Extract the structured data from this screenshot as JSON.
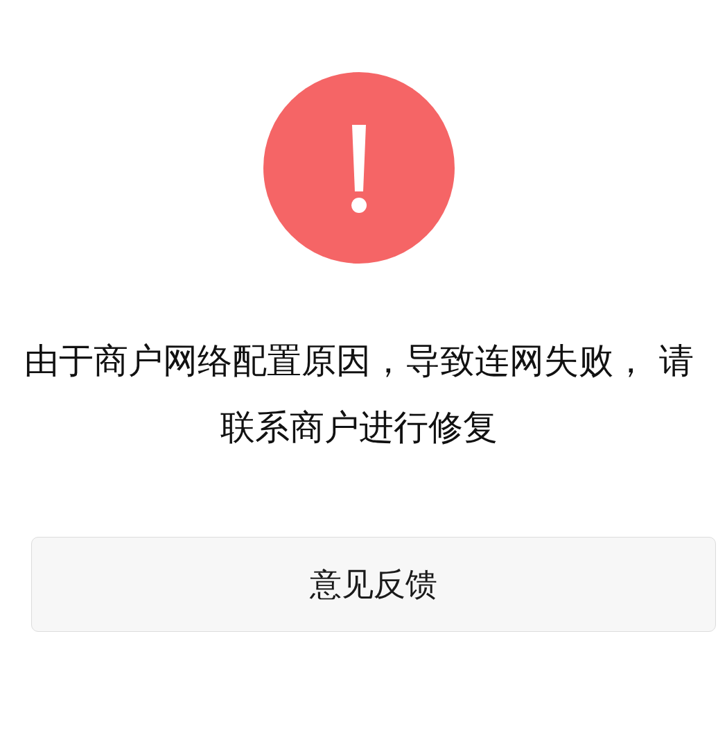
{
  "message": "由于商户网络配置原因，导致连网失败， 请联系商户进行修复",
  "button": {
    "label": "意见反馈"
  }
}
